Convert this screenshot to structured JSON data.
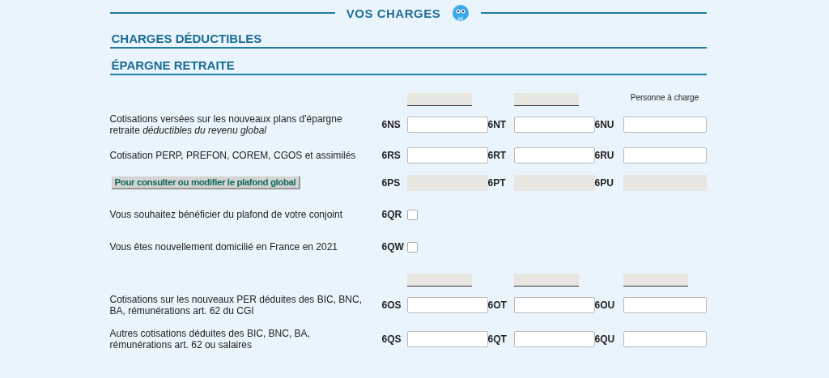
{
  "title": "VOS CHARGES",
  "sections": [
    "CHARGES DÉDUCTIBLES",
    "ÉPARGNE RETRAITE"
  ],
  "rows": [
    {
      "kind": "bars",
      "cells": [
        {
          "kind": "bar"
        },
        {
          "kind": "bar"
        },
        {
          "kind": "note",
          "text": "Personne à charge"
        }
      ]
    },
    {
      "kind": "inputs",
      "label": "Cotisations versées sur les nouveaux plans d'épargne retraite *déductibles du revenu global*",
      "cells": [
        {
          "code": "6NS"
        },
        {
          "code": "6NT"
        },
        {
          "code": "6NU"
        }
      ]
    },
    {
      "kind": "inputs",
      "label": "Cotisation PERP, PREFON, COREM, CGOS et assimilés",
      "cells": [
        {
          "code": "6RS"
        },
        {
          "code": "6RT"
        },
        {
          "code": "6RU"
        }
      ]
    },
    {
      "kind": "readonly",
      "button": "Pour consulter ou modifier le plafond global",
      "cells": [
        {
          "code": "6PS"
        },
        {
          "code": "6PT"
        },
        {
          "code": "6PU"
        }
      ]
    },
    {
      "kind": "checkbox",
      "label": "Vous souhaitez bénéficier du plafond de votre conjoint",
      "code": "6QR",
      "checked": false
    },
    {
      "kind": "checkbox",
      "label": "Vous êtes nouvellement domicilié en France en 2021",
      "code": "6QW",
      "checked": false
    },
    {
      "kind": "bars",
      "cells": [
        {
          "kind": "bar"
        },
        {
          "kind": "bar"
        },
        {
          "kind": "bar"
        }
      ]
    },
    {
      "kind": "inputs",
      "label": "Cotisations sur les nouveaux PER déduites des BIC, BNC, BA, rémunérations art. 62 du CGI",
      "cells": [
        {
          "code": "6OS"
        },
        {
          "code": "6OT"
        },
        {
          "code": "6OU"
        }
      ]
    },
    {
      "kind": "inputs",
      "label": "Autres cotisations déduites des BIC, BNC, BA, rémunérations art. 62 ou salaires",
      "cells": [
        {
          "code": "6QS"
        },
        {
          "code": "6QT"
        },
        {
          "code": "6QU"
        }
      ]
    }
  ]
}
